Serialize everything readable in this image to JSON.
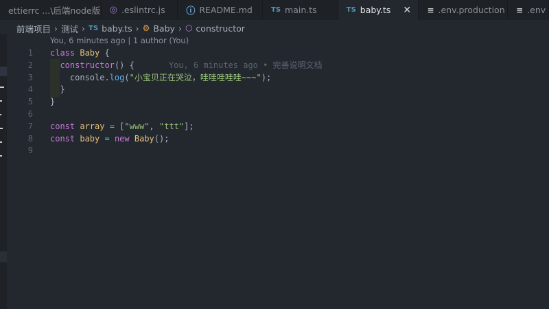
{
  "tabs": [
    {
      "label": "ettierrc  ...\\后端node版",
      "icon": "none"
    },
    {
      "label": ".eslintrc.js",
      "icon": "eslint-icon"
    },
    {
      "label": "README.md",
      "icon": "info-icon"
    },
    {
      "label": "main.ts",
      "icon": "ts-icon",
      "icon_text": "TS"
    },
    {
      "label": "baby.ts",
      "icon": "ts-icon",
      "icon_text": "TS",
      "active": true
    },
    {
      "label": ".env.production",
      "icon": "env-icon"
    },
    {
      "label": ".env",
      "icon": "env-icon"
    }
  ],
  "close_glyph": "✕",
  "breadcrumb": [
    "前端项目",
    "测试",
    "baby.ts",
    "Baby",
    "constructor"
  ],
  "breadcrumb_ts": "TS",
  "blame_header": "You, 6 minutes ago | 1 author (You)",
  "inline_blame": "You, 6 minutes ago • 完善说明文档",
  "line_numbers": [
    "1",
    "2",
    "3",
    "4",
    "5",
    "6",
    "7",
    "8",
    "9"
  ],
  "code": [
    [
      [
        "kw",
        "class "
      ],
      [
        "cls",
        "Baby "
      ],
      [
        "pl",
        "{"
      ]
    ],
    [
      [
        "pl",
        "  "
      ],
      [
        "fnp",
        "constructor"
      ],
      [
        "pl",
        "() {"
      ]
    ],
    [
      [
        "pl",
        "    console."
      ],
      [
        "fn",
        "log"
      ],
      [
        "pl",
        "("
      ],
      [
        "str",
        "\"小宝贝正在哭泣，哇哇哇哇哇~~~\""
      ],
      [
        "pl",
        ");"
      ]
    ],
    [
      [
        "pl",
        "  }"
      ]
    ],
    [
      [
        "pl",
        "}"
      ]
    ],
    [],
    [
      [
        "kw",
        "const "
      ],
      [
        "cls",
        "array "
      ],
      [
        "op",
        "= "
      ],
      [
        "pl",
        "["
      ],
      [
        "str",
        "\"www\""
      ],
      [
        "pl",
        ", "
      ],
      [
        "str",
        "\"ttt\""
      ],
      [
        "pl",
        "];"
      ]
    ],
    [
      [
        "kw",
        "const "
      ],
      [
        "cls",
        "baby "
      ],
      [
        "op",
        "= "
      ],
      [
        "kw",
        "new "
      ],
      [
        "cls",
        "Baby"
      ],
      [
        "pl",
        "();"
      ]
    ],
    []
  ]
}
